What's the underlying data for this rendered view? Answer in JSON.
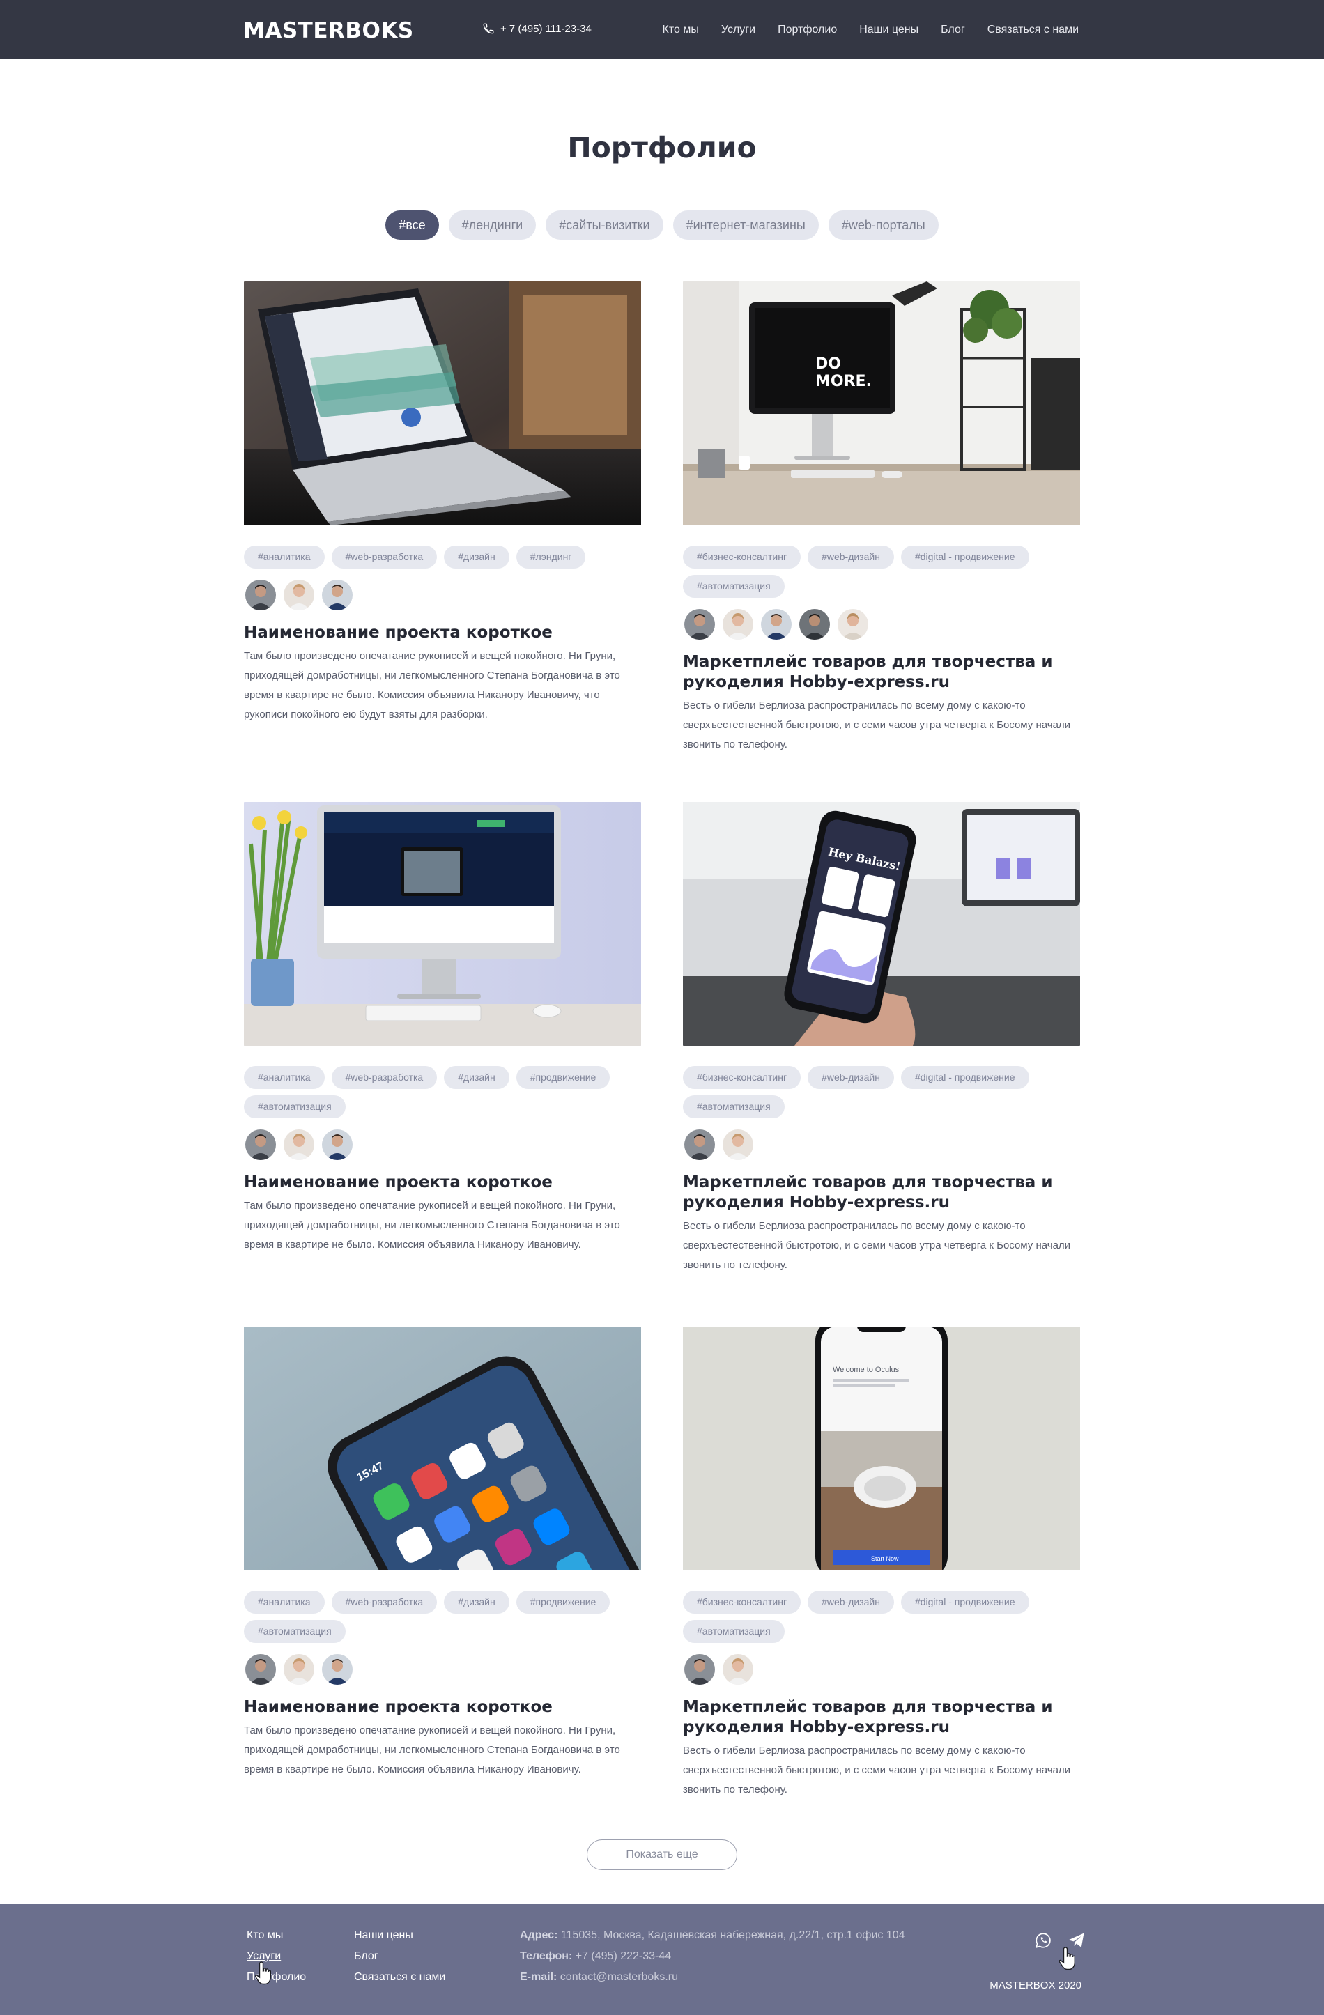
{
  "header": {
    "logo": "MASTERBOKS",
    "phone": "+ 7 (495) 111-23-34",
    "nav": [
      "Кто мы",
      "Услуги",
      "Портфолио",
      "Наши цены",
      "Блог",
      "Связаться с нами"
    ]
  },
  "page": {
    "title": "Портфолио",
    "filters": [
      "#все",
      "#лендинги",
      "#сайты-визитки",
      "#интернет-магазины",
      "#web-порталы"
    ],
    "active_filter": "#все"
  },
  "projects": [
    {
      "image": "laptop-analytics",
      "tags": [
        "#аналитика",
        "#web-разработка",
        "#дизайн",
        "#лэндинг"
      ],
      "avatars": 3,
      "title": "Наименование проекта короткое",
      "description": "Там было произведено опечатание рукописей и вещей покойного. Ни Груни, приходящей домработницы, ни легкомысленного Степана Богдановича в это время в квартире не было. Комиссия объявила Никанору Ивановичу, что рукописи покойного ею будут взяты для разборки."
    },
    {
      "image": "imac-do-more",
      "tags": [
        "#бизнес-консалтинг",
        "#web-дизайн",
        "#digital - продвижение",
        "#автоматизация"
      ],
      "avatars": 5,
      "title": "Маркетплейс товаров для творчества и рукоделия Hobby-express.ru",
      "description": "Весть о гибели Берлиоза распространилась по всему дому с какою-то сверхъестественной быстротою, и с семи часов утра четверга к Босому начали звонить по телефону."
    },
    {
      "image": "imac-website",
      "tags": [
        "#аналитика",
        "#web-разработка",
        "#дизайн",
        "#продвижение",
        "#автоматизация"
      ],
      "avatars": 3,
      "title": "Наименование проекта короткое",
      "description": "Там было произведено опечатание рукописей и вещей покойного. Ни Груни, приходящей домработницы, ни легкомысленного Степана Богдановича в это время в квартире не было. Комиссия объявила Никанору Ивановичу."
    },
    {
      "image": "phone-in-hand",
      "tags": [
        "#бизнес-консалтинг",
        "#web-дизайн",
        "#digital - продвижение",
        "#автоматизация"
      ],
      "avatars": 2,
      "title": "Маркетплейс товаров для творчества и рукоделия Hobby-express.ru",
      "description": "Весть о гибели Берлиоза распространилась по всему дому с какою-то сверхъестественной быстротою, и с семи часов утра четверга к Босому начали звонить по телефону."
    },
    {
      "image": "phone-home-screen",
      "tags": [
        "#аналитика",
        "#web-разработка",
        "#дизайн",
        "#продвижение",
        "#автоматизация"
      ],
      "avatars": 3,
      "title": "Наименование проекта короткое",
      "description": "Там было произведено опечатание рукописей и вещей покойного. Ни Груни, приходящей домработницы, ни легкомысленного Степана Богдановича в это время в квартире не было. Комиссия объявила Никанору Ивановичу."
    },
    {
      "image": "phone-oculus",
      "tags": [
        "#бизнес-консалтинг",
        "#web-дизайн",
        "#digital - продвижение",
        "#автоматизация"
      ],
      "avatars": 2,
      "title": "Маркетплейс товаров для творчества и рукоделия Hobby-express.ru",
      "description": "Весть о гибели Берлиоза распространилась по всему дому с какою-то сверхъестественной быстротою, и с семи часов утра четверга к Босому начали звонить по телефону."
    }
  ],
  "image_text": {
    "do_more_line1": "DO",
    "do_more_line2": "MORE.",
    "oculus_welcome": "Welcome to Oculus",
    "oculus_start": "Start Now",
    "phone_greeting": "Hey Balazs!",
    "phone_time": "15:47"
  },
  "show_more": "Показать еще",
  "footer": {
    "col1": [
      "Кто мы",
      "Услуги",
      "Портфолио"
    ],
    "col2": [
      "Наши цены",
      "Блог",
      "Связаться с нами"
    ],
    "address_label": "Адрес:",
    "address": "115035, Москва, Кадашёвская набережная, д.22/1, стр.1 офис 104",
    "phone_label": "Телефон:",
    "phone": "+7 (495) 222-33-44",
    "email_label": "E-mail:",
    "email": "contact@masterboks.ru",
    "copyright": "MASTERBOX 2020",
    "socials": [
      "whatsapp-icon",
      "telegram-icon"
    ]
  }
}
